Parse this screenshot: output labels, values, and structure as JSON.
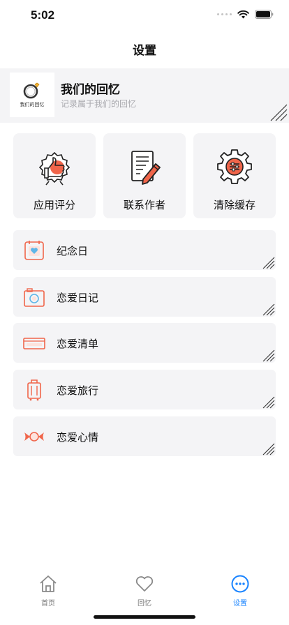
{
  "status_bar": {
    "time": "5:02"
  },
  "nav": {
    "title": "设置"
  },
  "app_header": {
    "logo_text": "我们的回忆",
    "name": "我们的回忆",
    "description": "记录属于我们的回忆"
  },
  "grid": [
    {
      "label": "应用评分",
      "icon": "thumbs-up-badge-icon"
    },
    {
      "label": "联系作者",
      "icon": "note-pencil-icon"
    },
    {
      "label": "清除缓存",
      "icon": "gear-sliders-icon"
    }
  ],
  "rows": [
    {
      "label": "纪念日",
      "icon": "calendar-heart-icon"
    },
    {
      "label": "恋爱日记",
      "icon": "camera-icon"
    },
    {
      "label": "恋爱清单",
      "icon": "envelope-icon"
    },
    {
      "label": "恋爱旅行",
      "icon": "suitcase-icon"
    },
    {
      "label": "恋爱心情",
      "icon": "candy-icon"
    }
  ],
  "tabs": [
    {
      "label": "首页",
      "icon": "home-icon"
    },
    {
      "label": "回忆",
      "icon": "heart-icon"
    },
    {
      "label": "设置",
      "icon": "more-dots-icon",
      "active": true
    }
  ],
  "colors": {
    "accent": "#f0654a",
    "tab_active": "#1a84ff",
    "card_bg": "#f4f4f6"
  }
}
